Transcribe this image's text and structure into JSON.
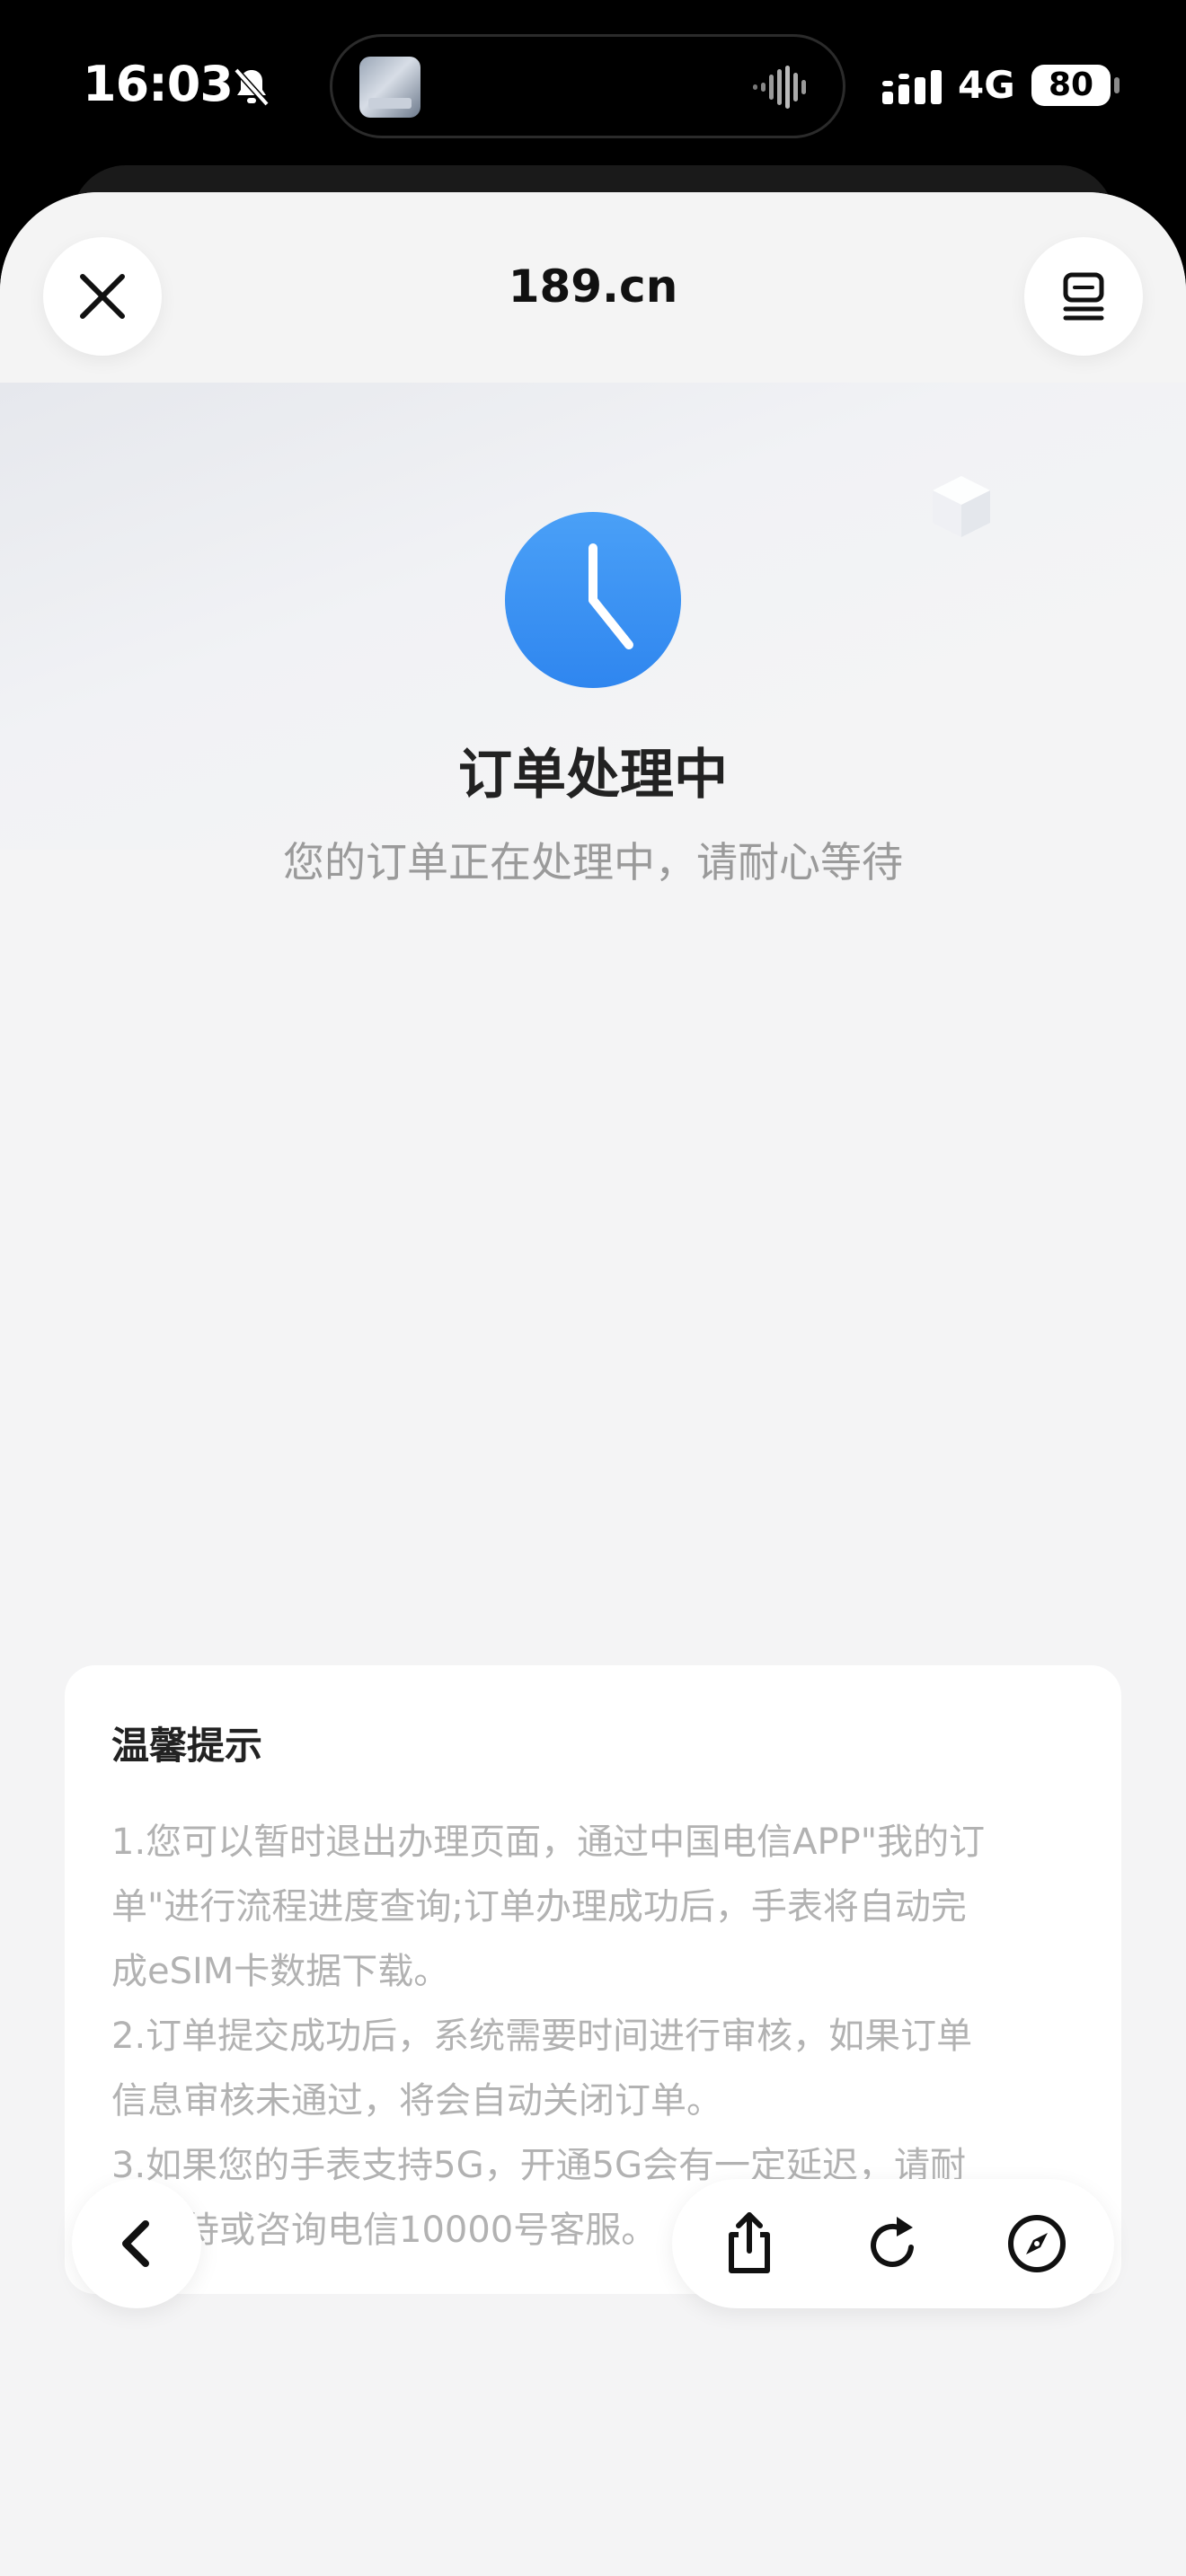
{
  "status_bar": {
    "time": "16:03",
    "network": "4G",
    "battery": "80"
  },
  "browser": {
    "site_title": "189.cn"
  },
  "order": {
    "status_title": "订单处理中",
    "status_subtitle": "您的订单正在处理中，请耐心等待"
  },
  "tips": {
    "title": "温馨提示",
    "lines": [
      "1.您可以暂时退出办理页面，通过中国电信APP\"我的订",
      "单\"进行流程进度查询;订单办理成功后，手表将自动完",
      "成eSIM卡数据下载。",
      "2.订单提交成功后，系统需要时间进行审核，如果订单",
      "信息审核未通过，将会自动关闭订单。",
      "3.如果您的手表支持5G，开通5G会有一定延迟，请耐",
      "心等待或咨询电信10000号客服。"
    ]
  },
  "icons": {
    "close": "close-icon",
    "tabs": "tabs-icon",
    "clock": "clock-icon",
    "back": "chevron-left-icon",
    "share": "share-icon",
    "reload": "reload-icon",
    "compass": "compass-icon"
  },
  "colors": {
    "accent_blue": "#3d8ef2",
    "sheet_bg": "#f4f4f5",
    "tip_text": "#b2b2b2"
  }
}
